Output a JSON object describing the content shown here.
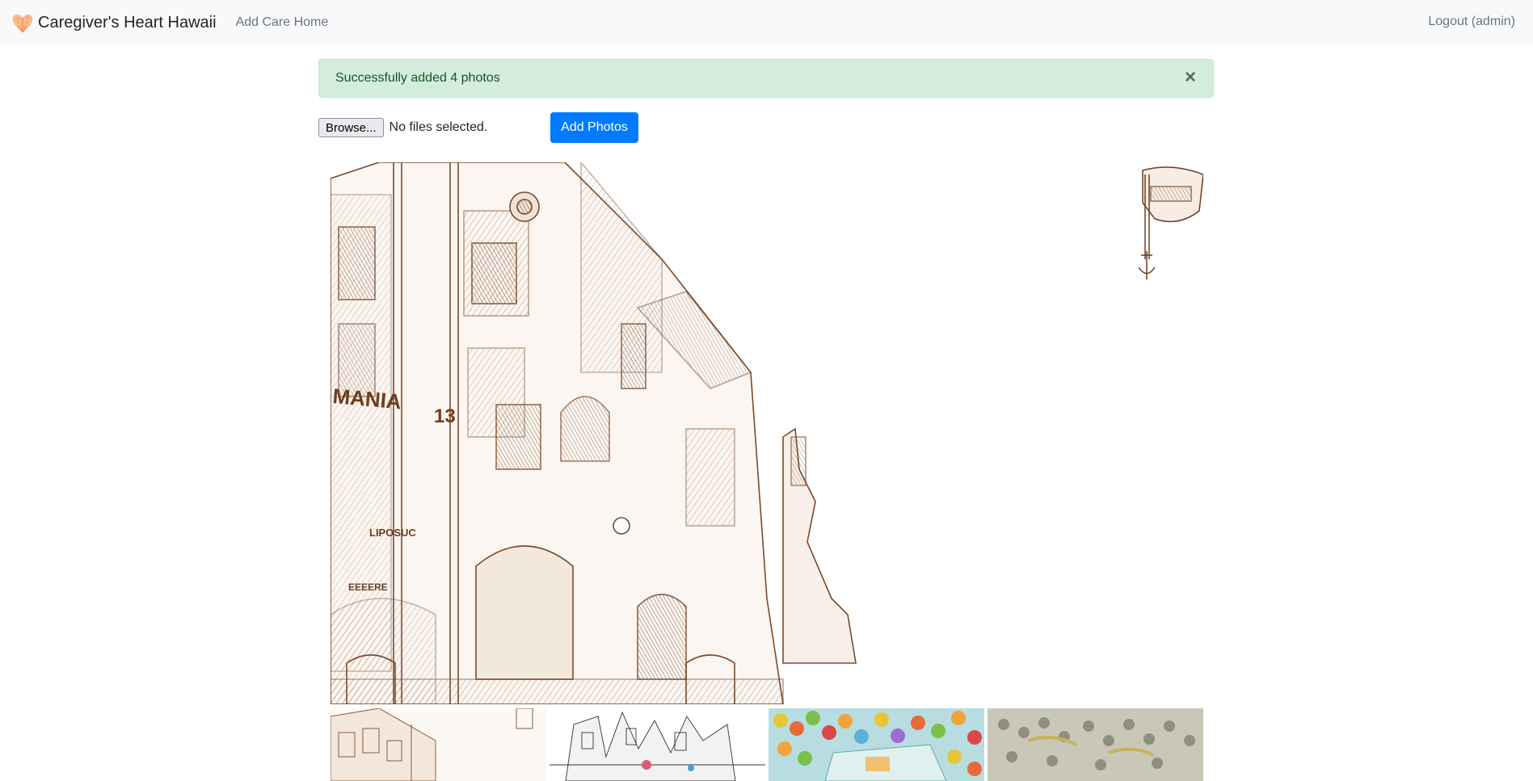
{
  "navbar": {
    "brand_name": "Caregiver's Heart Hawaii",
    "logo_icon": "heart-leaf-logo-icon",
    "links": {
      "add_care_home": "Add Care Home"
    },
    "logout_label": "Logout (admin)"
  },
  "alert": {
    "message": "Successfully added 4 photos",
    "close_glyph": "×",
    "type": "success"
  },
  "upload": {
    "browse_label": "Browse...",
    "file_status": "No files selected.",
    "submit_label": "Add Photos"
  },
  "gallery": {
    "main_photo": {
      "description_icon": "sepia-city-sketch-image",
      "sign_text_1": "MANIA",
      "sign_text_2": "13",
      "sign_text_3": "LIPOSUC",
      "sign_text_4": "EEEERE"
    },
    "thumbnails": [
      {
        "icon": "sepia-building-thumbnail"
      },
      {
        "icon": "ink-city-thumbnail"
      },
      {
        "icon": "colorful-crowd-thumbnail"
      },
      {
        "icon": "grey-crowd-thumbnail"
      }
    ]
  },
  "colors": {
    "navbar_bg": "#f8f9fa",
    "alert_bg": "#d4edda",
    "alert_text": "#155724",
    "primary": "#007bff",
    "sepia": "#7a4a2a"
  }
}
